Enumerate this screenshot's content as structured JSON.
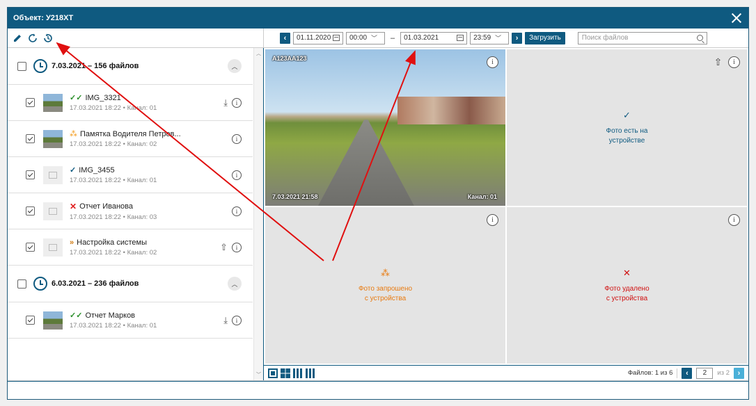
{
  "window": {
    "title": "Объект: У218ХТ"
  },
  "toolbar": {
    "date_from": "01.11.2020",
    "time_from": "00:00",
    "dash": "–",
    "date_to": "01.03.2021",
    "time_to": "23:59",
    "load_label": "Загрузить",
    "search_placeholder": "Поиск файлов"
  },
  "groups": [
    {
      "title": "7.03.2021 – 156 файлов",
      "items": [
        {
          "name": "IMG_3321",
          "status": "synced-both",
          "meta_date": "17.03.2021 18:22",
          "meta_channel": "Канал: 01",
          "thumb": "photo",
          "checked": true,
          "download": true
        },
        {
          "name": "Памятка Водителя Петров...",
          "status": "requested",
          "meta_date": "17.03.2021 18:22",
          "meta_channel": "Канал: 02",
          "thumb": "photo",
          "checked": true,
          "download": false
        },
        {
          "name": "IMG_3455",
          "status": "on-device",
          "meta_date": "17.03.2021 18:22",
          "meta_channel": "Канал: 01",
          "thumb": "placeholder",
          "checked": true,
          "download": false
        },
        {
          "name": "Отчет Иванова",
          "status": "deleted",
          "meta_date": "17.03.2021 18:22",
          "meta_channel": "Канал: 03",
          "thumb": "placeholder",
          "checked": true,
          "download": false
        },
        {
          "name": "Настройка системы",
          "status": "in-progress",
          "meta_date": "17.03.2021 18:22",
          "meta_channel": "Канал: 02",
          "thumb": "placeholder",
          "checked": true,
          "download": false,
          "upload": true
        }
      ]
    },
    {
      "title": "6.03.2021 – 236 файлов",
      "items": [
        {
          "name": "Отчет Марков",
          "status": "synced-both",
          "meta_date": "17.03.2021 18:22",
          "meta_channel": "Канал: 01",
          "thumb": "photo",
          "checked": true,
          "download": true
        }
      ]
    }
  ],
  "cells": {
    "photo": {
      "plate": "А123АА123",
      "timestamp": "7.03.2021 21:58",
      "channel": "Канал: 01"
    },
    "on_device": {
      "line1": "Фото есть на",
      "line2": "устройстве"
    },
    "requested": {
      "line1": "Фото запрошено",
      "line2": "с устройства"
    },
    "deleted": {
      "line1": "Фото удалено",
      "line2": "с устройства"
    }
  },
  "pager": {
    "files_label": "Файлов: 1 из 6",
    "page": "2",
    "of_label": "из 2"
  },
  "colors": {
    "brand": "#0f5a80",
    "ok": "#2a8f2a",
    "pending": "#f39a1a",
    "deleted": "#e02020",
    "annotation": "#e01010"
  }
}
